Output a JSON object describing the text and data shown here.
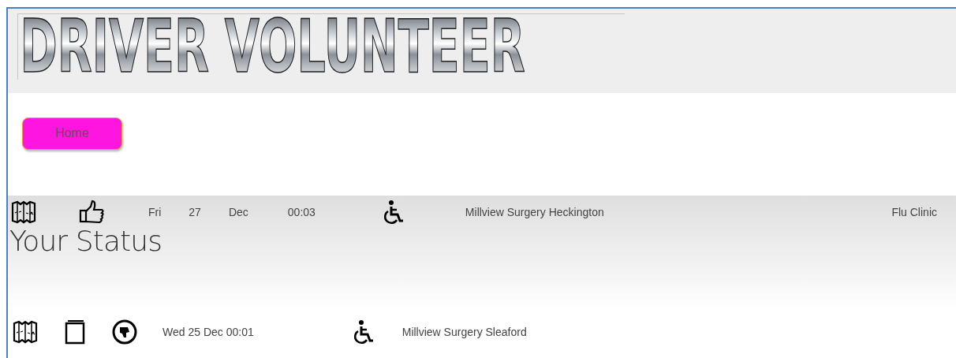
{
  "logo": {
    "text": "DRIVER VOLUNTEER"
  },
  "nav": [
    {
      "label": "Home"
    }
  ],
  "job": {
    "day": "Fri",
    "date": "27",
    "month": "Dec",
    "time": "00:03",
    "location": "Millview Surgery Heckington",
    "type": "Flu Clinic"
  },
  "status_heading": "Your Status",
  "status_rows": [
    {
      "datetime": "Wed 25 Dec 00:01",
      "location": "Millview Surgery Sleaford"
    }
  ]
}
